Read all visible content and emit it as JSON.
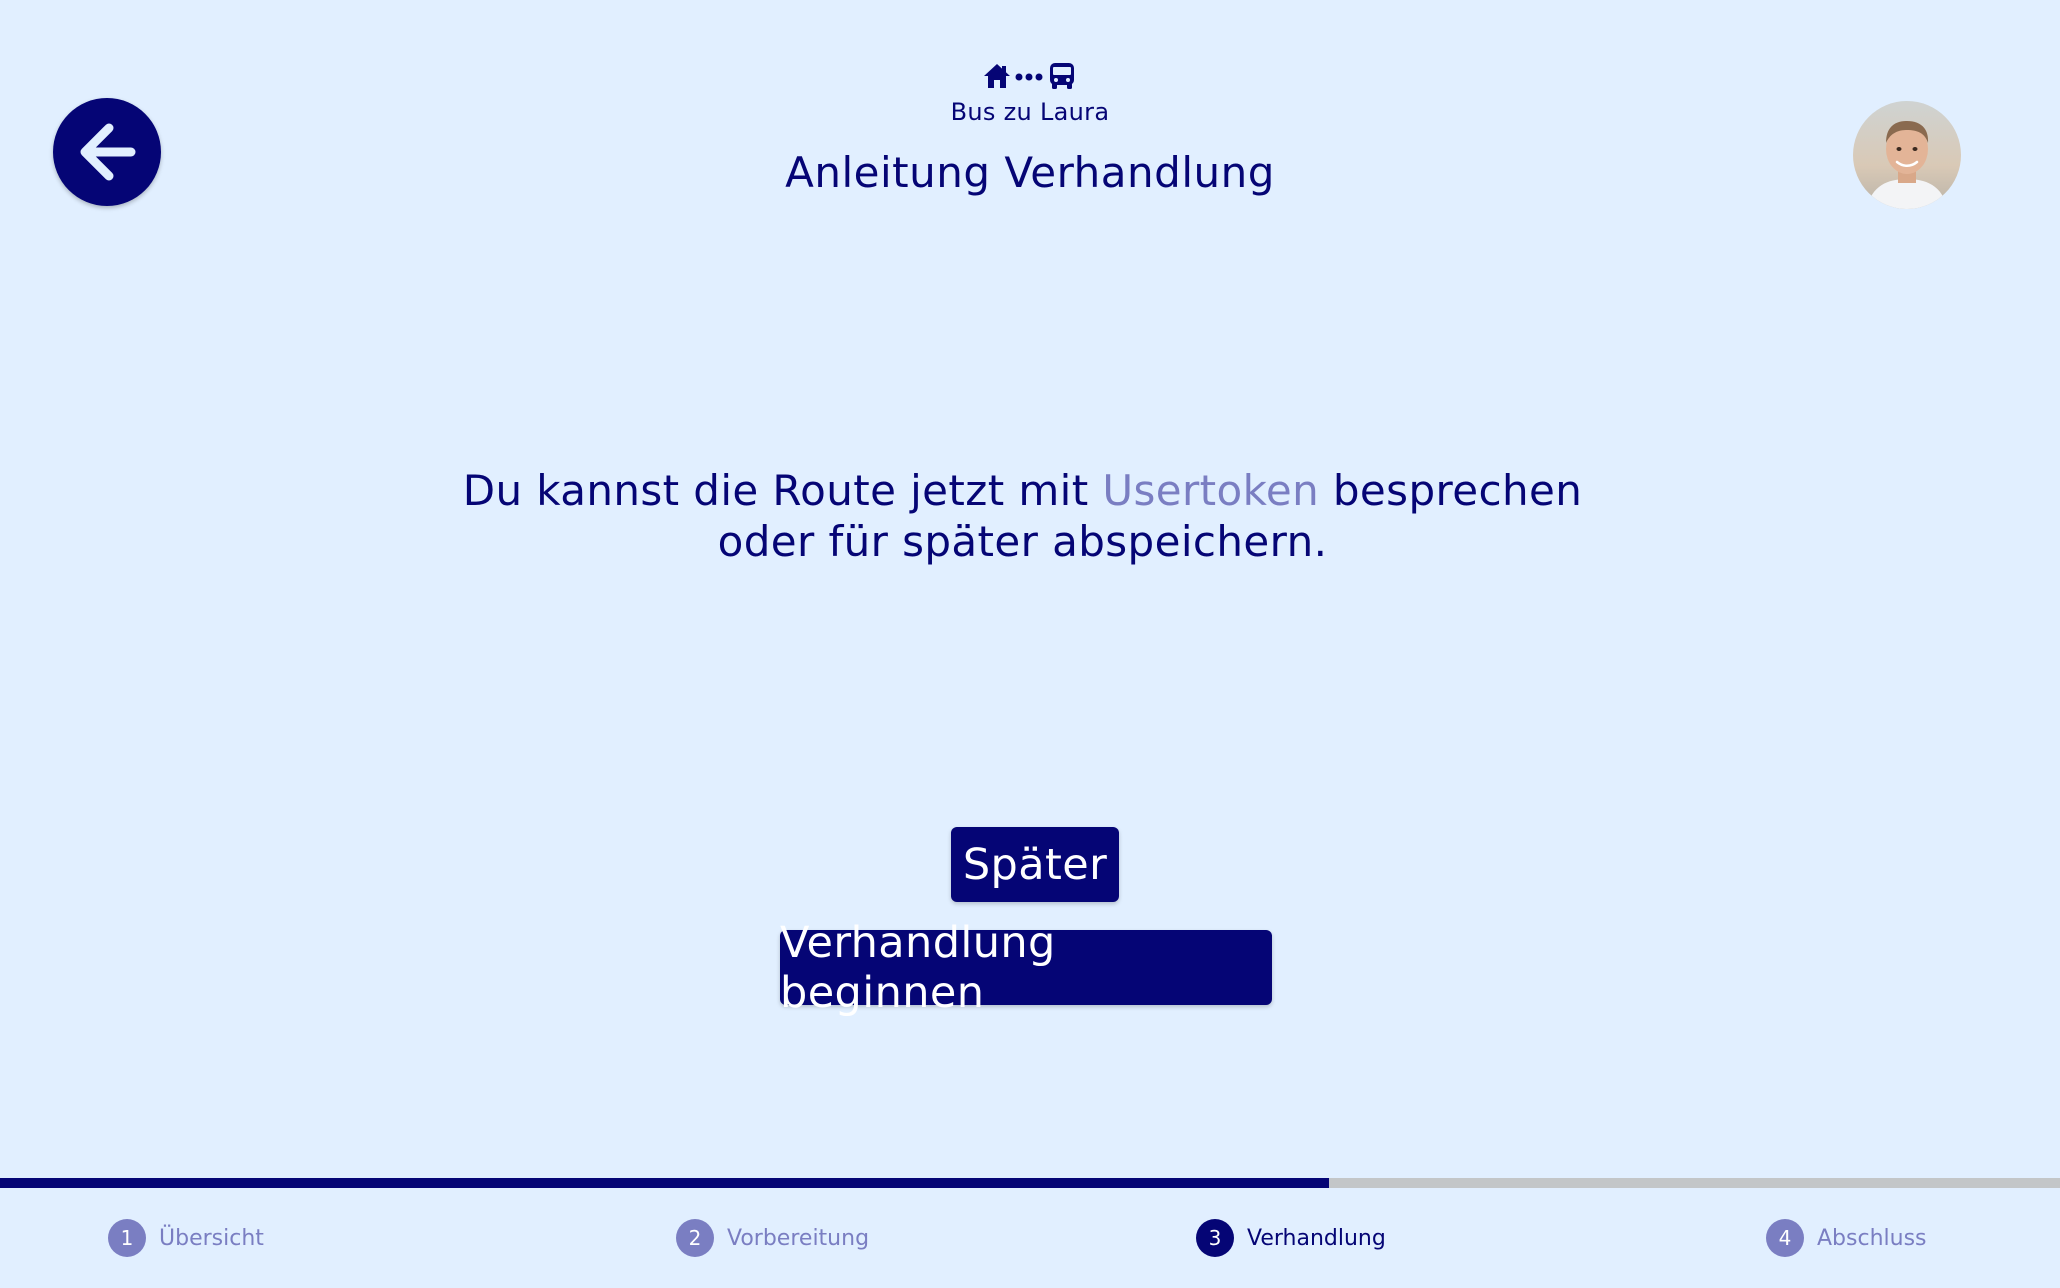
{
  "header": {
    "route_icons": [
      "home-icon",
      "dots-icon",
      "bus-icon"
    ],
    "subtitle": "Bus zu Laura",
    "title": "Anleitung Verhandlung"
  },
  "navigation": {
    "back_icon": "arrow-left-icon"
  },
  "profile": {
    "avatar": "user-avatar"
  },
  "message": {
    "part1": "Du kannst die Route jetzt mit ",
    "highlight": "Usertoken",
    "part2": " besprechen",
    "line2": "oder für später abspeichern."
  },
  "actions": {
    "later_label": "Später",
    "begin_label": "Verhandlung beginnen"
  },
  "progress": {
    "fraction": 0.645,
    "steps": [
      {
        "number": "1",
        "label": "Übersicht",
        "active": false
      },
      {
        "number": "2",
        "label": "Vorbereitung",
        "active": false
      },
      {
        "number": "3",
        "label": "Verhandlung",
        "active": true
      },
      {
        "number": "4",
        "label": "Abschluss",
        "active": false
      }
    ]
  },
  "colors": {
    "background": "#e1efff",
    "primary": "#050575",
    "accent": "#7a7ec2",
    "track": "#c3c6c8"
  }
}
